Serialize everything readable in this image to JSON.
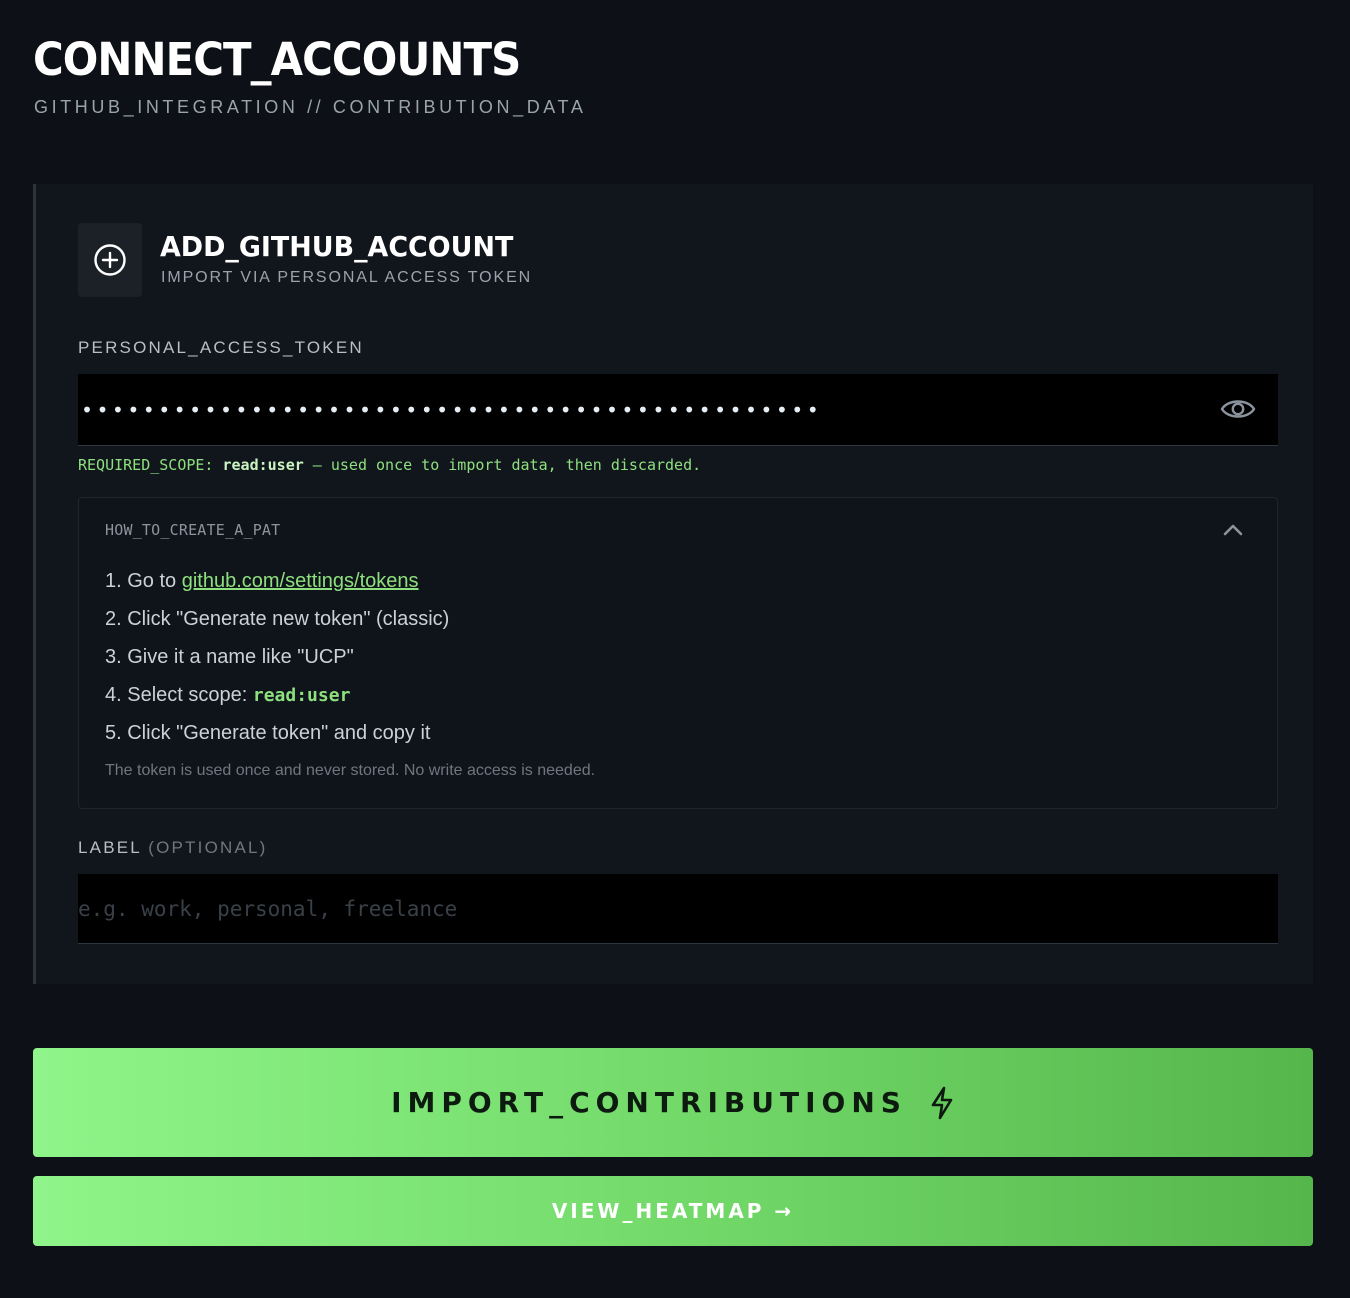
{
  "header": {
    "title": "CONNECT_ACCOUNTS",
    "subtitle": "GITHUB_INTEGRATION // CONTRIBUTION_DATA"
  },
  "card": {
    "icon": "plus-circle-icon",
    "title": "ADD_GITHUB_ACCOUNT",
    "subtitle": "IMPORT VIA PERSONAL ACCESS TOKEN",
    "token_field": {
      "label": "PERSONAL_ACCESS_TOKEN",
      "value_masked": "••••••••••••••••••••••••••••••••••••••••••••••••",
      "toggle_icon": "eye-icon"
    },
    "scope_note": {
      "prefix": "REQUIRED_SCOPE: ",
      "scope": "read:user",
      "suffix": " — used once to import data, then discarded."
    },
    "howto": {
      "title": "HOW_TO_CREATE_A_PAT",
      "toggle_icon": "chevron-up-icon",
      "steps": [
        {
          "prefix": "1. Go to ",
          "link": "github.com/settings/tokens"
        },
        {
          "text": "2. Click \"Generate new token\" (classic)"
        },
        {
          "text": "3. Give it a name like \"UCP\""
        },
        {
          "prefix": "4. Select scope: ",
          "code": "read:user"
        },
        {
          "text": "5. Click \"Generate token\" and copy it"
        }
      ],
      "note": "The token is used once and never stored. No write access is needed."
    },
    "label_field": {
      "label": "LABEL",
      "optional": "(OPTIONAL)",
      "placeholder": "e.g. work, personal, freelance",
      "value": ""
    }
  },
  "actions": {
    "import_label": "IMPORT_CONTRIBUTIONS",
    "import_icon": "lightning-bolt-icon",
    "heatmap_label": "VIEW_HEATMAP →"
  },
  "colors": {
    "background": "#0d1117",
    "card": "#11161c",
    "accent": "#8ee07f",
    "button_gradient_start": "#8ff58a",
    "button_gradient_end": "#55b64c"
  }
}
